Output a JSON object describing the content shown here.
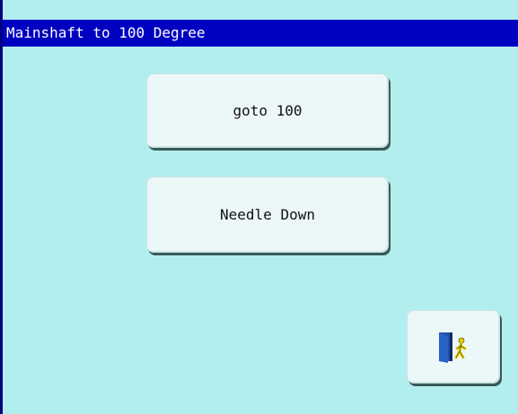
{
  "window": {
    "title": "Mainshaft to 100 Degree"
  },
  "buttons": {
    "goto_label": "goto 100",
    "needle_down_label": "Needle Down",
    "exit_icon": "exit-door-icon"
  },
  "colors": {
    "background": "#b3eeee",
    "title_bar": "#0000c0",
    "button_face": "#ecf7f7",
    "door_blue": "#1f4fa8",
    "figure_yellow": "#e8d000"
  }
}
